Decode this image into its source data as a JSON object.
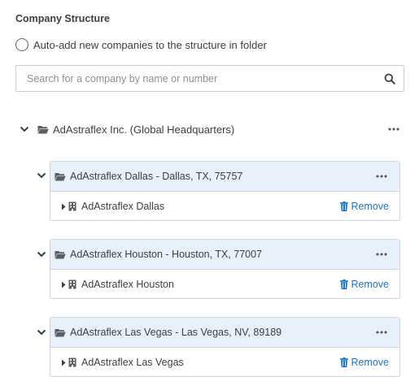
{
  "section_title": "Company Structure",
  "auto_add": {
    "label": "Auto-add new companies to the structure in folder",
    "checked": false
  },
  "search": {
    "placeholder": "Search for a company by name or number",
    "value": ""
  },
  "root": {
    "label": "AdAstraflex Inc. (Global Headquarters)",
    "expanded": true
  },
  "groups": [
    {
      "folder_label": "AdAstraflex Dallas - Dallas, TX, 75757",
      "company_label": "AdAstraflex Dallas",
      "remove_label": "Remove"
    },
    {
      "folder_label": "AdAstraflex Houston - Houston, TX, 77007",
      "company_label": "AdAstraflex Houston",
      "remove_label": "Remove"
    },
    {
      "folder_label": "AdAstraflex Las Vegas - Las Vegas, NV, 89189",
      "company_label": "AdAstraflex Las Vegas",
      "remove_label": "Remove"
    }
  ],
  "colors": {
    "accent": "#1a73c9",
    "card_header_bg": "#e8f0fb",
    "text": "#3a3f46"
  },
  "icons": [
    "search-icon",
    "chevron-down-icon",
    "folder-open-icon",
    "more-icon",
    "caret-right-icon",
    "building-icon",
    "trash-icon"
  ]
}
